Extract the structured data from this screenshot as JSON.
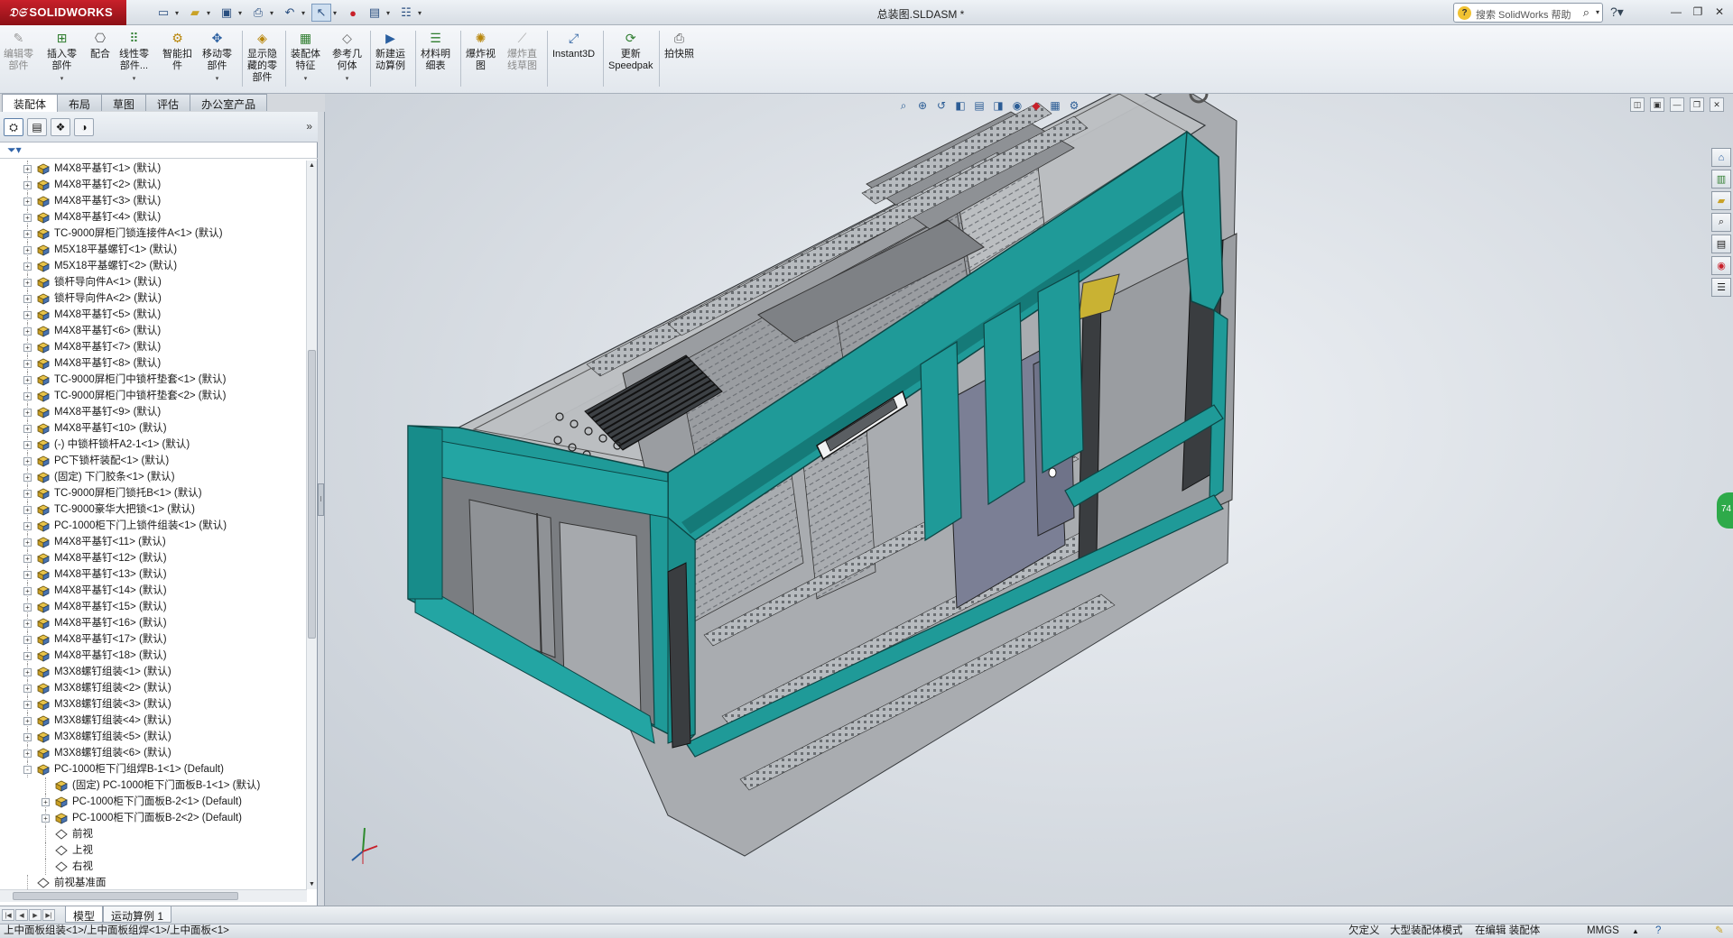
{
  "app": {
    "brand": "SOLIDWORKS",
    "document_title": "总装图.SLDASM *",
    "help_search_placeholder": "搜索 SolidWorks 帮助"
  },
  "commands": [
    {
      "label": "编辑零\n部件",
      "icon": "edit-component-icon",
      "disabled": true
    },
    {
      "label": "插入零\n部件",
      "icon": "insert-component-icon",
      "disabled": false,
      "arrow": true
    },
    {
      "label": "配合",
      "icon": "mate-icon",
      "disabled": false
    },
    {
      "label": "线性零\n部件...",
      "icon": "linear-pattern-icon",
      "disabled": false,
      "arrow": true
    },
    {
      "label": "智能扣\n件",
      "icon": "smart-fastener-icon",
      "disabled": false
    },
    {
      "label": "移动零\n部件",
      "icon": "move-component-icon",
      "disabled": false,
      "arrow": true
    },
    {
      "label": "显示隐\n藏的零\n部件",
      "icon": "show-hidden-icon",
      "disabled": false
    },
    {
      "label": "装配体\n特征",
      "icon": "assembly-feature-icon",
      "disabled": false,
      "arrow": true
    },
    {
      "label": "参考几\n何体",
      "icon": "reference-geometry-icon",
      "disabled": false,
      "arrow": true
    },
    {
      "label": "新建运\n动算例",
      "icon": "new-motion-study-icon",
      "disabled": false
    },
    {
      "label": "材料明\n细表",
      "icon": "bom-icon",
      "disabled": false
    },
    {
      "label": "爆炸视\n图",
      "icon": "exploded-view-icon",
      "disabled": false
    },
    {
      "label": "爆炸直\n线草图",
      "icon": "explode-line-sketch-icon",
      "disabled": true
    },
    {
      "label": "Instant3D",
      "icon": "instant3d-icon",
      "disabled": false
    },
    {
      "label": "更新\nSpeedpak",
      "icon": "speedpak-icon",
      "disabled": false
    },
    {
      "label": "拍快照",
      "icon": "snapshot-icon",
      "disabled": false
    }
  ],
  "tabs": [
    "装配体",
    "布局",
    "草图",
    "评估",
    "办公室产品"
  ],
  "tree": [
    {
      "label": "M4X8平基钉<1> (默认)",
      "level": 0,
      "expander": "+",
      "type": "part"
    },
    {
      "label": "M4X8平基钉<2> (默认)",
      "level": 0,
      "expander": "+",
      "type": "part"
    },
    {
      "label": "M4X8平基钉<3> (默认)",
      "level": 0,
      "expander": "+",
      "type": "part"
    },
    {
      "label": "M4X8平基钉<4> (默认)",
      "level": 0,
      "expander": "+",
      "type": "part"
    },
    {
      "label": "TC-9000屏柜门锁连接件A<1> (默认)",
      "level": 0,
      "expander": "+",
      "type": "part"
    },
    {
      "label": "M5X18平基螺钉<1> (默认)",
      "level": 0,
      "expander": "+",
      "type": "part"
    },
    {
      "label": "M5X18平基螺钉<2> (默认)",
      "level": 0,
      "expander": "+",
      "type": "part"
    },
    {
      "label": "锁杆导向件A<1> (默认)",
      "level": 0,
      "expander": "+",
      "type": "part"
    },
    {
      "label": "锁杆导向件A<2> (默认)",
      "level": 0,
      "expander": "+",
      "type": "part"
    },
    {
      "label": "M4X8平基钉<5> (默认)",
      "level": 0,
      "expander": "+",
      "type": "part"
    },
    {
      "label": "M4X8平基钉<6> (默认)",
      "level": 0,
      "expander": "+",
      "type": "part"
    },
    {
      "label": "M4X8平基钉<7> (默认)",
      "level": 0,
      "expander": "+",
      "type": "part"
    },
    {
      "label": "M4X8平基钉<8> (默认)",
      "level": 0,
      "expander": "+",
      "type": "part"
    },
    {
      "label": "TC-9000屏柜门中锁杆垫套<1> (默认)",
      "level": 0,
      "expander": "+",
      "type": "part"
    },
    {
      "label": "TC-9000屏柜门中锁杆垫套<2> (默认)",
      "level": 0,
      "expander": "+",
      "type": "part"
    },
    {
      "label": "M4X8平基钉<9> (默认)",
      "level": 0,
      "expander": "+",
      "type": "part"
    },
    {
      "label": "M4X8平基钉<10> (默认)",
      "level": 0,
      "expander": "+",
      "type": "part"
    },
    {
      "label": "(-) 中锁杆锁杆A2-1<1> (默认)",
      "level": 0,
      "expander": "+",
      "type": "part"
    },
    {
      "label": "PC下锁杆装配<1> (默认)",
      "level": 0,
      "expander": "+",
      "type": "part"
    },
    {
      "label": "(固定) 下门胶条<1> (默认)",
      "level": 0,
      "expander": "+",
      "type": "part"
    },
    {
      "label": "TC-9000屏柜门锁托B<1> (默认)",
      "level": 0,
      "expander": "+",
      "type": "part"
    },
    {
      "label": "TC-9000豪华大把锁<1> (默认)",
      "level": 0,
      "expander": "+",
      "type": "part"
    },
    {
      "label": "PC-1000柜下门上锁件组装<1> (默认)",
      "level": 0,
      "expander": "+",
      "type": "part"
    },
    {
      "label": "M4X8平基钉<11> (默认)",
      "level": 0,
      "expander": "+",
      "type": "part"
    },
    {
      "label": "M4X8平基钉<12> (默认)",
      "level": 0,
      "expander": "+",
      "type": "part"
    },
    {
      "label": "M4X8平基钉<13> (默认)",
      "level": 0,
      "expander": "+",
      "type": "part"
    },
    {
      "label": "M4X8平基钉<14> (默认)",
      "level": 0,
      "expander": "+",
      "type": "part"
    },
    {
      "label": "M4X8平基钉<15> (默认)",
      "level": 0,
      "expander": "+",
      "type": "part"
    },
    {
      "label": "M4X8平基钉<16> (默认)",
      "level": 0,
      "expander": "+",
      "type": "part"
    },
    {
      "label": "M4X8平基钉<17> (默认)",
      "level": 0,
      "expander": "+",
      "type": "part"
    },
    {
      "label": "M4X8平基钉<18> (默认)",
      "level": 0,
      "expander": "+",
      "type": "part"
    },
    {
      "label": "M3X8螺钉组装<1> (默认)",
      "level": 0,
      "expander": "+",
      "type": "part"
    },
    {
      "label": "M3X8螺钉组装<2> (默认)",
      "level": 0,
      "expander": "+",
      "type": "part"
    },
    {
      "label": "M3X8螺钉组装<3> (默认)",
      "level": 0,
      "expander": "+",
      "type": "part"
    },
    {
      "label": "M3X8螺钉组装<4> (默认)",
      "level": 0,
      "expander": "+",
      "type": "part"
    },
    {
      "label": "M3X8螺钉组装<5> (默认)",
      "level": 0,
      "expander": "+",
      "type": "part"
    },
    {
      "label": "M3X8螺钉组装<6> (默认)",
      "level": 0,
      "expander": "+",
      "type": "part"
    },
    {
      "label": "PC-1000柜下门组焊B-1<1> (Default)",
      "level": 0,
      "expander": "-",
      "type": "part"
    },
    {
      "label": "(固定) PC-1000柜下门面板B-1<1> (默认)",
      "level": 1,
      "expander": "",
      "type": "part"
    },
    {
      "label": "PC-1000柜下门面板B-2<1> (Default)",
      "level": 1,
      "expander": "+",
      "type": "part"
    },
    {
      "label": "PC-1000柜下门面板B-2<2> (Default)",
      "level": 1,
      "expander": "+",
      "type": "part"
    },
    {
      "label": "前视",
      "level": 1,
      "expander": "",
      "type": "plane"
    },
    {
      "label": "上视",
      "level": 1,
      "expander": "",
      "type": "plane"
    },
    {
      "label": "右视",
      "level": 1,
      "expander": "",
      "type": "plane"
    },
    {
      "label": "前视基准面",
      "level": 0,
      "expander": "",
      "type": "plane"
    }
  ],
  "model_tabs": [
    "模型",
    "运动算例 1"
  ],
  "status": {
    "path": "上中面板组装<1>/上中面板组焊<1>/上中面板<1>",
    "definition": "欠定义",
    "mode": "大型装配体模式",
    "editing": "在编辑 装配体",
    "units": "MMGS",
    "units_arrow": "▲"
  },
  "taskpane_badge": "74",
  "colors": {
    "cabinet_teal": "#1f9a98",
    "accent_red": "#c8202a"
  }
}
